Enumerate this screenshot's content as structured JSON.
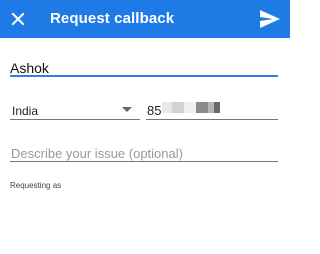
{
  "appbar": {
    "title": "Request callback",
    "close_icon": "close-icon",
    "send_icon": "send-icon",
    "color": "#1e7be6"
  },
  "form": {
    "name_value": "Ashok",
    "country_value": "India",
    "phone_value": "85",
    "issue_placeholder": "Describe your issue (optional)",
    "requesting_as_label": "Requesting as"
  },
  "colors": {
    "active_underline": "#2f7fe0",
    "inactive_underline": "#777777",
    "placeholder": "#999999"
  }
}
